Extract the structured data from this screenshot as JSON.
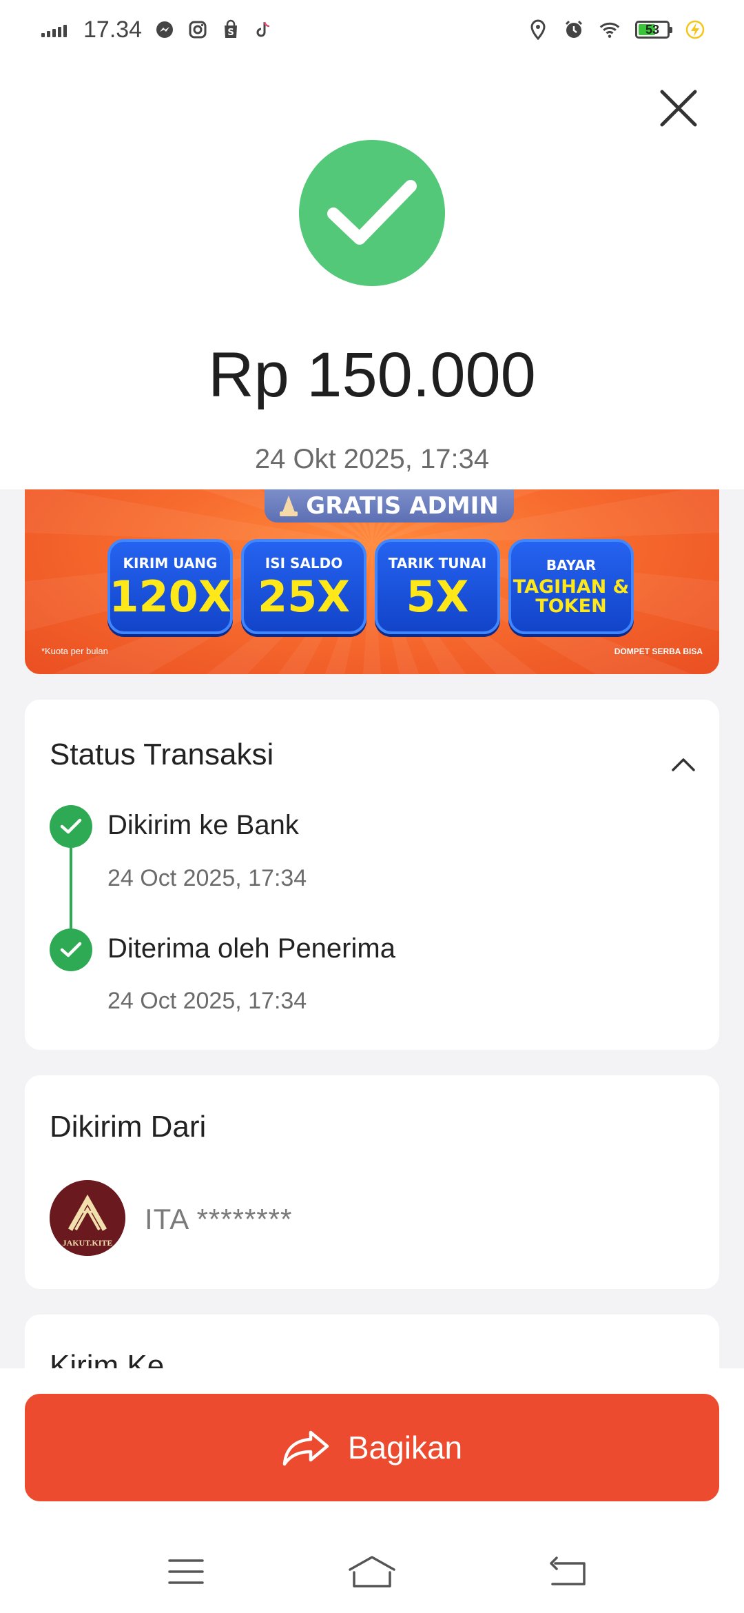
{
  "status_bar": {
    "time": "17.34",
    "battery_level": "53"
  },
  "transaction": {
    "amount": "Rp 150.000",
    "datetime": "24 Okt 2025, 17:34"
  },
  "banner": {
    "title": "GRATIS ADMIN",
    "tiles": [
      {
        "label": "KIRIM UANG",
        "value": "120X"
      },
      {
        "label": "ISI SALDO",
        "value": "25X"
      },
      {
        "label": "TARIK TUNAI",
        "value": "5X"
      },
      {
        "label": "BAYAR",
        "value": "TAGIHAN & TOKEN"
      }
    ],
    "note": "*Kuota per bulan",
    "brand": "DOMPET SERBA BISA"
  },
  "status_card": {
    "title": "Status Transaksi",
    "steps": [
      {
        "title": "Dikirim ke Bank",
        "time": "24 Oct 2025, 17:34"
      },
      {
        "title": "Diterima oleh Penerima",
        "time": "24 Oct 2025, 17:34"
      }
    ]
  },
  "sender_card": {
    "title": "Dikirim Dari",
    "logo_text": "JAKUT.KITE",
    "name": "ITA ********"
  },
  "recipient_card": {
    "title": "Kirim Ke"
  },
  "share_button": {
    "label": "Bagikan"
  },
  "colors": {
    "success_green": "#52c878",
    "timeline_green": "#2faa54",
    "primary_orange": "#ec4b2f",
    "background": "#f3f3f5"
  },
  "icons": {
    "close": "close-icon",
    "success": "checkmark-icon",
    "collapse": "chevron-up-icon",
    "share": "share-arrow-icon",
    "nav_menu": "menu-icon",
    "nav_home": "home-icon",
    "nav_back": "back-icon"
  }
}
